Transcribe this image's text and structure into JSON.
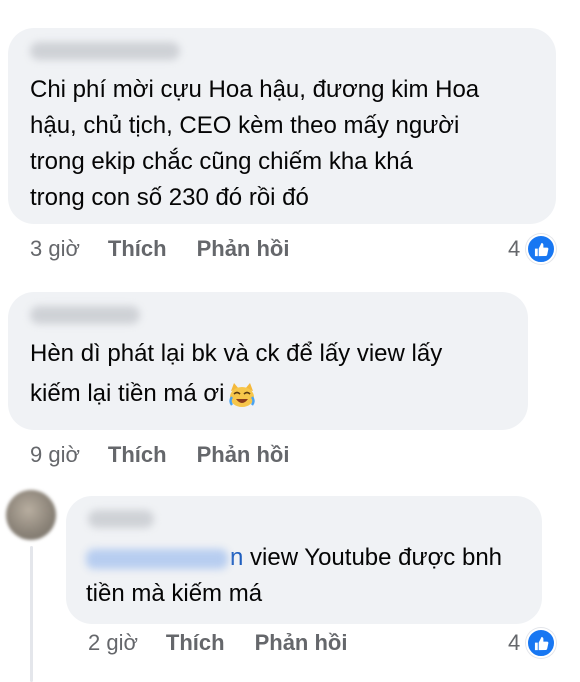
{
  "comments": [
    {
      "text_lines": [
        "Chi phí mời cựu Hoa hậu, đương kim Hoa",
        "hậu, chủ tịch, CEO kèm theo mấy người",
        "trong ekip chắc cũng chiếm kha khá",
        "trong con số 230 đó rồi đó"
      ],
      "time": "3 giờ",
      "like_label": "Thích",
      "reply_label": "Phản hồi",
      "reaction_count": "4",
      "reaction_icon": "like-icon"
    },
    {
      "text_lines": [
        "Hèn dì phát lại bk và ck để lấy view lấy",
        "kiếm lại tiền má ơi"
      ],
      "emoji": "crying-laughing-cat-emoji",
      "time": "9 giờ",
      "like_label": "Thích",
      "reply_label": "Phản hồi"
    },
    {
      "mention_tail": "n",
      "text_line1_rest": " view Youtube được bnh",
      "text_line2": "tiền mà kiếm má",
      "time": "2 giờ",
      "like_label": "Thích",
      "reply_label": "Phản hồi",
      "reaction_count": "4",
      "reaction_icon": "like-icon"
    }
  ],
  "colors": {
    "bubble": "#f0f2f5",
    "meta_text": "#65676b",
    "like_blue": "#1877f2",
    "mention": "#1f5fbf"
  }
}
